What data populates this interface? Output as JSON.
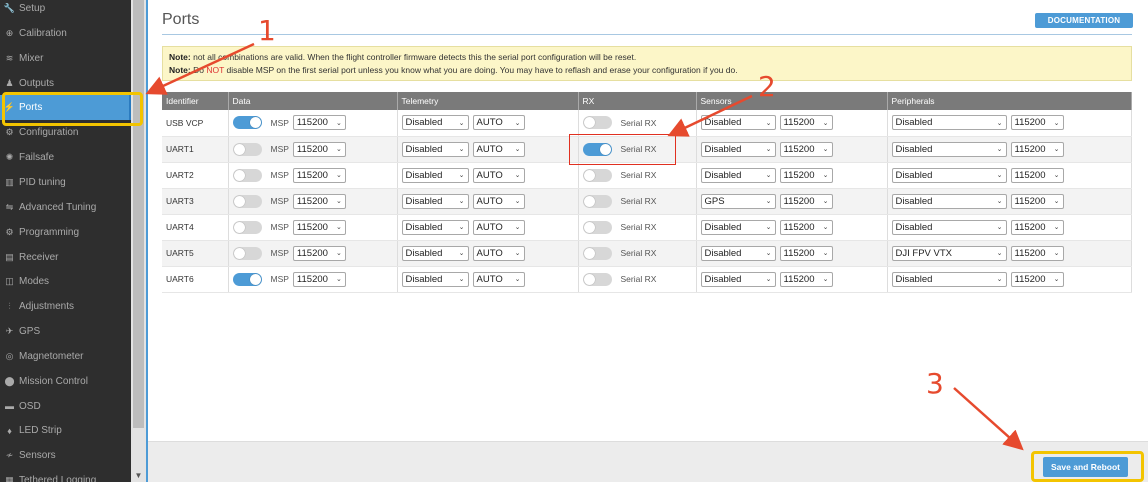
{
  "sidebar": {
    "items": [
      {
        "label": "Setup",
        "icon": "wrench-icon",
        "glyph": "🔧",
        "active": false
      },
      {
        "label": "Calibration",
        "icon": "crosshair-icon",
        "glyph": "⊕",
        "active": false
      },
      {
        "label": "Mixer",
        "icon": "mixer-icon",
        "glyph": "≋",
        "active": false
      },
      {
        "label": "Outputs",
        "icon": "motor-icon",
        "glyph": "♟",
        "active": false
      },
      {
        "label": "Ports",
        "icon": "plug-icon",
        "glyph": "⚡",
        "active": true
      },
      {
        "label": "Configuration",
        "icon": "gear-icon",
        "glyph": "⚙",
        "active": false
      },
      {
        "label": "Failsafe",
        "icon": "failsafe-icon",
        "glyph": "✺",
        "active": false
      },
      {
        "label": "PID tuning",
        "icon": "pid-icon",
        "glyph": "▥",
        "active": false
      },
      {
        "label": "Advanced Tuning",
        "icon": "tuning-icon",
        "glyph": "⇋",
        "active": false
      },
      {
        "label": "Programming",
        "icon": "cog-icon",
        "glyph": "⚙",
        "active": false
      },
      {
        "label": "Receiver",
        "icon": "receiver-icon",
        "glyph": "▤",
        "active": false
      },
      {
        "label": "Modes",
        "icon": "modes-icon",
        "glyph": "◫",
        "active": false
      },
      {
        "label": "Adjustments",
        "icon": "sliders-icon",
        "glyph": "⫶",
        "active": false
      },
      {
        "label": "GPS",
        "icon": "satellite-icon",
        "glyph": "✈",
        "active": false
      },
      {
        "label": "Magnetometer",
        "icon": "compass-icon",
        "glyph": "◎",
        "active": false
      },
      {
        "label": "Mission Control",
        "icon": "map-pin-icon",
        "glyph": "⬤",
        "active": false
      },
      {
        "label": "OSD",
        "icon": "osd-icon",
        "glyph": "▬",
        "active": false
      },
      {
        "label": "LED Strip",
        "icon": "led-icon",
        "glyph": "♦",
        "active": false
      },
      {
        "label": "Sensors",
        "icon": "sensor-icon",
        "glyph": "≁",
        "active": false
      },
      {
        "label": "Tethered Logging",
        "icon": "log-icon",
        "glyph": "▦",
        "active": false
      }
    ]
  },
  "header": {
    "title": "Ports",
    "doc_button": "DOCUMENTATION"
  },
  "note": {
    "line1_bold": "Note:",
    "line1_text": " not all combinations are valid. When the flight controller firmware detects this the serial port configuration will be reset.",
    "line2_bold": "Note:",
    "line2_pre": " Do ",
    "line2_red": "NOT",
    "line2_post": " disable MSP on the first serial port unless you know what you are doing. You may have to reflash and erase your configuration if you do."
  },
  "table": {
    "headers": [
      "Identifier",
      "Data",
      "Telemetry",
      "RX",
      "Sensors",
      "Peripherals"
    ],
    "msp_label": "MSP",
    "serial_rx_label": "Serial RX",
    "rows": [
      {
        "id": "USB VCP",
        "msp": true,
        "msp_baud": "115200",
        "telemetry": "Disabled",
        "telemetry_baud": "AUTO",
        "serial_rx": false,
        "sensors": "Disabled",
        "sensors_baud": "115200",
        "peripherals": "Disabled",
        "peripherals_baud": "115200"
      },
      {
        "id": "UART1",
        "msp": false,
        "msp_baud": "115200",
        "telemetry": "Disabled",
        "telemetry_baud": "AUTO",
        "serial_rx": true,
        "sensors": "Disabled",
        "sensors_baud": "115200",
        "peripherals": "Disabled",
        "peripherals_baud": "115200"
      },
      {
        "id": "UART2",
        "msp": false,
        "msp_baud": "115200",
        "telemetry": "Disabled",
        "telemetry_baud": "AUTO",
        "serial_rx": false,
        "sensors": "Disabled",
        "sensors_baud": "115200",
        "peripherals": "Disabled",
        "peripherals_baud": "115200"
      },
      {
        "id": "UART3",
        "msp": false,
        "msp_baud": "115200",
        "telemetry": "Disabled",
        "telemetry_baud": "AUTO",
        "serial_rx": false,
        "sensors": "GPS",
        "sensors_baud": "115200",
        "peripherals": "Disabled",
        "peripherals_baud": "115200"
      },
      {
        "id": "UART4",
        "msp": false,
        "msp_baud": "115200",
        "telemetry": "Disabled",
        "telemetry_baud": "AUTO",
        "serial_rx": false,
        "sensors": "Disabled",
        "sensors_baud": "115200",
        "peripherals": "Disabled",
        "peripherals_baud": "115200"
      },
      {
        "id": "UART5",
        "msp": false,
        "msp_baud": "115200",
        "telemetry": "Disabled",
        "telemetry_baud": "AUTO",
        "serial_rx": false,
        "sensors": "Disabled",
        "sensors_baud": "115200",
        "peripherals": "DJI FPV VTX",
        "peripherals_baud": "115200"
      },
      {
        "id": "UART6",
        "msp": true,
        "msp_baud": "115200",
        "telemetry": "Disabled",
        "telemetry_baud": "AUTO",
        "serial_rx": false,
        "sensors": "Disabled",
        "sensors_baud": "115200",
        "peripherals": "Disabled",
        "peripherals_baud": "115200"
      }
    ]
  },
  "footer": {
    "save_button": "Save and Reboot"
  },
  "annotations": {
    "step1": "1",
    "step2": "2",
    "step3": "3"
  },
  "colors": {
    "accent": "#4d9bd6",
    "sidebar_bg": "#2e2e2e",
    "highlight_yellow": "#f3c400",
    "annotation_red": "#e64a2e"
  }
}
